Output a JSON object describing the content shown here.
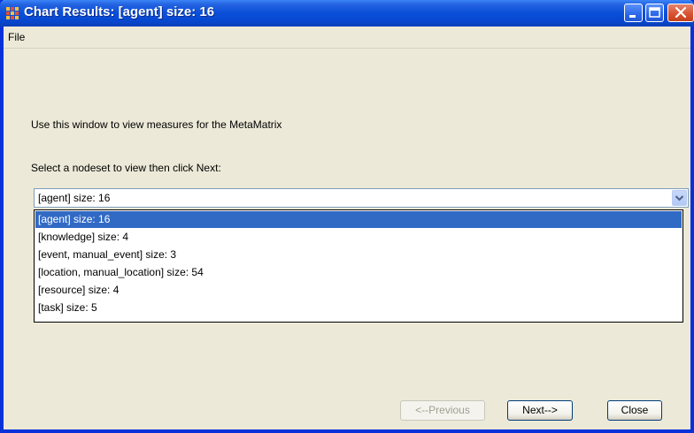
{
  "window": {
    "title": "Chart Results: [agent] size: 16"
  },
  "menu": {
    "file": "File"
  },
  "content": {
    "instruction": "Use this window to view measures for the MetaMatrix",
    "prompt": "Select a nodeset to view then click Next:"
  },
  "nodeset_select": {
    "value": "[agent] size: 16",
    "options": [
      "[agent] size: 16",
      "[knowledge] size: 4",
      "[event, manual_event] size: 3",
      "[location, manual_location] size: 54",
      "[resource] size: 4",
      "[task] size: 5"
    ]
  },
  "buttons": {
    "previous": "<--Previous",
    "next": "Next-->",
    "close": "Close"
  },
  "colors": {
    "titlebar": "#0a4fd9",
    "selection": "#316ac5",
    "background": "#ece9d8",
    "close_button": "#d6512f"
  },
  "icons": {
    "app": "ora-grid-icon",
    "minimize": "minimize-icon",
    "maximize": "maximize-icon",
    "close": "close-icon",
    "dropdown": "chevron-down-icon"
  }
}
